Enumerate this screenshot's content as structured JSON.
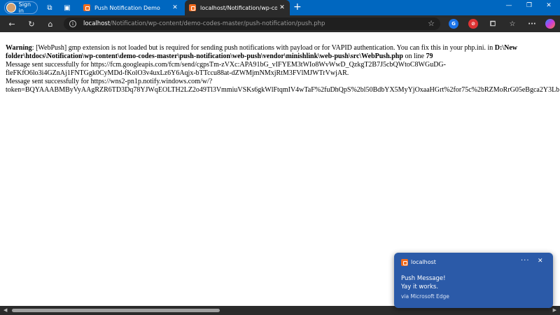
{
  "browser": {
    "profile_label": "Sign in",
    "tabs": [
      {
        "title": "Push Notification Demo",
        "close": "✕"
      },
      {
        "title": "localhost/Notification/wp-content",
        "close": "✕"
      }
    ],
    "new_tab": "+",
    "window": {
      "minimize": "—",
      "restore": "❐",
      "close": "✕"
    }
  },
  "address_bar": {
    "host": "localhost",
    "path": "/Notification/wp-content/demo-codes-master/push-notification/push.php"
  },
  "page": {
    "warning_label": "Warning",
    "warning_text": ": [WebPush] gmp extension is not loaded but is required for sending push notifications with payload or for VAPID authentication. You can fix this in your php.ini. in ",
    "warning_path_start": "D:\\New",
    "warning_path_rest": "folder\\htdocs\\Notification\\wp-content\\demo-codes-master\\push-notification\\web-push\\vendor\\minishlink\\web-push\\src\\WebPush.php",
    "on_line_text": " on line ",
    "line_number": "79",
    "message1_line1": "Message sent successfully for https://fcm.googleapis.com/fcm/send/cgpsTm-zVXc:APA91bG_vIFYEM3tWIo8WvWwD_QzkgT2B7J5cbQWtoC8WGuDG-",
    "message1_line2": "fleFKfO6lo3i4GZnAj1FNTGgk0CyMDd-fKolO3v4uxLz6Y6Aqjx-bTTccu88at-dZWMjmNMxjRtM3FVlMJWTrVwjAR.",
    "message2_line1": "Message sent successfully for https://wns2-pn1p.notify.windows.com/w/?",
    "message2_line2": "token=BQYAAABMByVyAAgRZR6TD3Dq78YJWqEOLTH2LZ2o49Tl3VmmiuVSKs6gkWlFtqmIV4wTaF%2fuDhQpS%2bl50BdbYX5MyYjOxaaHGrt%2for75c%2bRZMoRrG05eBgca2Y3Lb"
  },
  "notification": {
    "app": "localhost",
    "more": "···",
    "close": "✕",
    "title": "Push Message!",
    "body": "Yay it works.",
    "source": "via Microsoft Edge"
  },
  "colors": {
    "tabbar": "#0067c0",
    "toast": "#2b5aa8",
    "favicon": "#f26b1d"
  }
}
